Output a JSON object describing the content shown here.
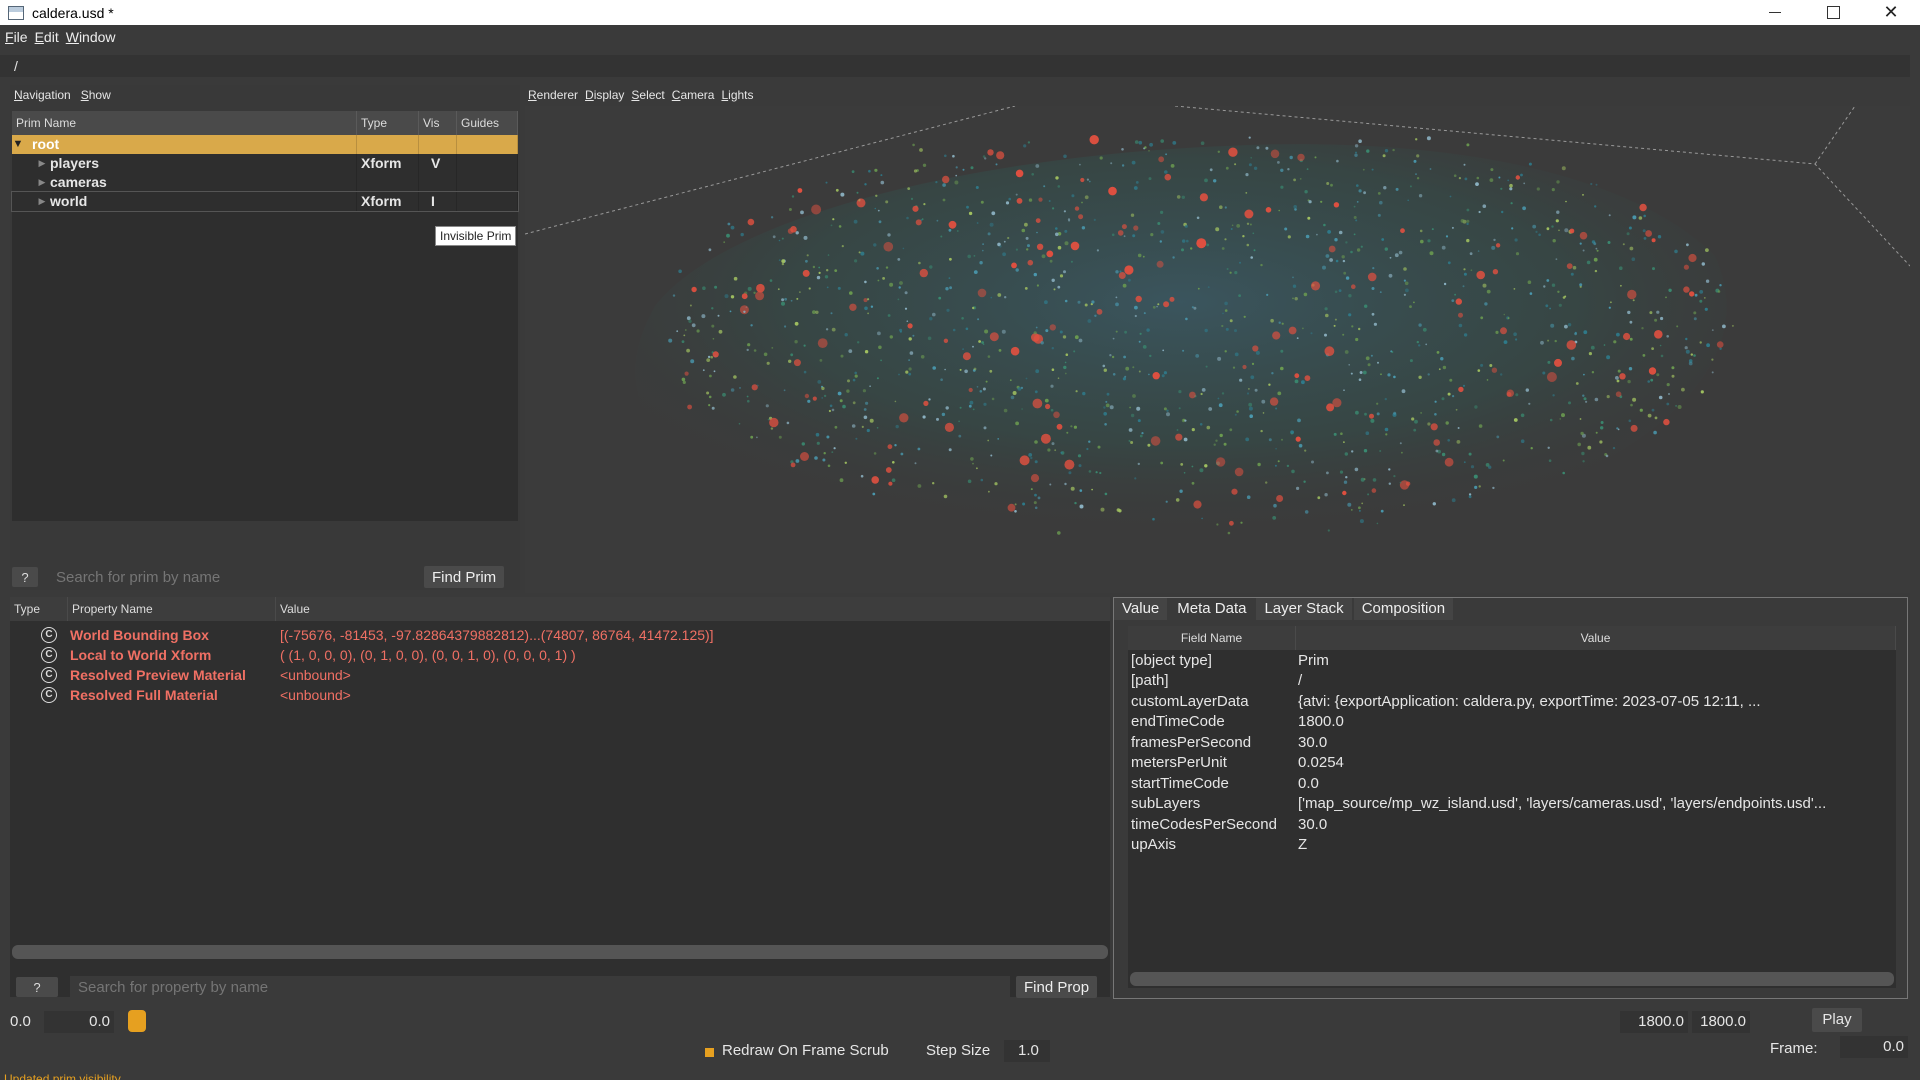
{
  "window": {
    "title": "caldera.usd *",
    "controls": {
      "minimize": "minimize-icon",
      "maximize": "maximize-icon",
      "close": "✕"
    }
  },
  "menu": [
    "File",
    "Edit",
    "Window"
  ],
  "path": "/",
  "nav_menu": [
    "Navigation",
    "Show"
  ],
  "tree": {
    "headers": {
      "name": "Prim Name",
      "type": "Type",
      "vis": "Vis",
      "guides": "Guides"
    },
    "rows": [
      {
        "name": "root",
        "type": "",
        "vis": "",
        "expanded": true
      },
      {
        "name": "players",
        "type": "Xform",
        "vis": "V"
      },
      {
        "name": "cameras",
        "type": "",
        "vis": ""
      },
      {
        "name": "world",
        "type": "Xform",
        "vis": "I"
      }
    ],
    "tooltip": "Invisible Prim"
  },
  "prim_search": {
    "help": "?",
    "placeholder": "Search for prim by name",
    "button": "Find Prim"
  },
  "viewport_menu": [
    "Renderer",
    "Display",
    "Select",
    "Camera",
    "Lights"
  ],
  "properties": {
    "headers": {
      "type": "Type",
      "name": "Property Name",
      "value": "Value"
    },
    "rows": [
      {
        "name": "World Bounding Box",
        "value": "[(-75676, -81453, -97.82864379882812)...(74807, 86764, 41472.125)]"
      },
      {
        "name": "Local to World Xform",
        "value": "( (1, 0, 0, 0), (0, 1, 0, 0), (0, 0, 1, 0), (0, 0, 0, 1) )"
      },
      {
        "name": "Resolved Preview Material",
        "value": "<unbound>"
      },
      {
        "name": "Resolved Full Material",
        "value": "<unbound>"
      }
    ],
    "icon_glyph": "C"
  },
  "prop_search": {
    "help": "?",
    "placeholder": "Search for property by name",
    "button": "Find Prop"
  },
  "meta": {
    "tabs": [
      "Value",
      "Meta Data",
      "Layer Stack",
      "Composition"
    ],
    "headers": {
      "field": "Field Name",
      "value": "Value"
    },
    "rows": [
      {
        "field": "[object type]",
        "value": "Prim"
      },
      {
        "field": "[path]",
        "value": "/"
      },
      {
        "field": "customLayerData",
        "value": "{atvi: {exportApplication: caldera.py, exportTime: 2023-07-05 12:11, ..."
      },
      {
        "field": "endTimeCode",
        "value": "1800.0"
      },
      {
        "field": "framesPerSecond",
        "value": "30.0"
      },
      {
        "field": "metersPerUnit",
        "value": "0.0254"
      },
      {
        "field": "startTimeCode",
        "value": "0.0"
      },
      {
        "field": "subLayers",
        "value": "['map_source/mp_wz_island.usd', 'layers/cameras.usd', 'layers/endpoints.usd'..."
      },
      {
        "field": "timeCodesPerSecond",
        "value": "30.0"
      },
      {
        "field": "upAxis",
        "value": "Z"
      }
    ]
  },
  "timeline": {
    "start": "0.0",
    "current": "0.0",
    "end1": "1800.0",
    "end2": "1800.0",
    "play": "Play",
    "redraw_label": "Redraw On Frame Scrub",
    "step_label": "Step Size",
    "step_value": "1.0",
    "frame_label": "Frame:",
    "frame_value": "0.0"
  },
  "status": "Updated prim visibility",
  "colors": {
    "accent": "#e6a020",
    "property_text": "#f07064",
    "selection": "#d9a94a"
  }
}
